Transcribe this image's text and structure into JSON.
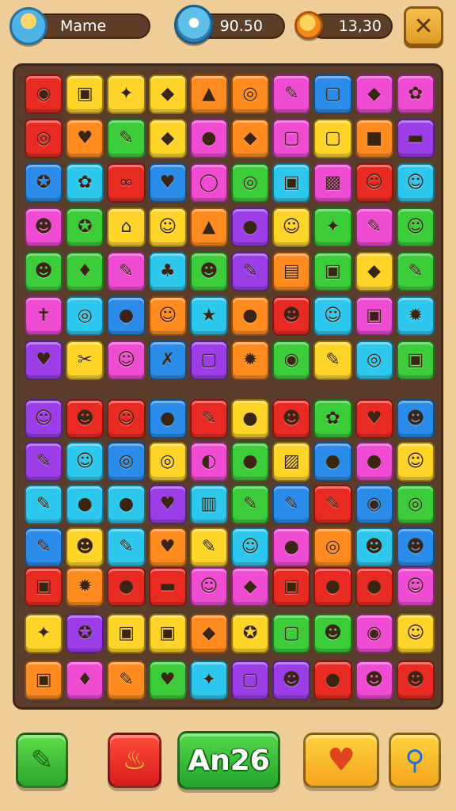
{
  "hud": {
    "player_name": "Mame",
    "gems": "90.50",
    "coins": "13,30",
    "close_glyph": "✕"
  },
  "colors": {
    "red": "#e82a22",
    "orange": "#ff8a1e",
    "yellow": "#ffd428",
    "green": "#3ccc3a",
    "blue": "#2a8be8",
    "cyan": "#2ec8ee",
    "purple": "#9b3ee8",
    "magenta": "#ef4bd3"
  },
  "board": {
    "sections": [
      {
        "rows": [
          [
            [
              "red",
              "◉"
            ],
            [
              "yellow",
              "▣"
            ],
            [
              "yellow",
              "✦"
            ],
            [
              "yellow",
              "◆"
            ],
            [
              "orange",
              "▲"
            ],
            [
              "orange",
              "◎"
            ],
            [
              "magenta",
              "✎"
            ],
            [
              "blue",
              "▢"
            ],
            [
              "magenta",
              "◆"
            ],
            [
              "magenta",
              "✿"
            ]
          ],
          [
            [
              "red",
              "◎"
            ],
            [
              "orange",
              "♥"
            ],
            [
              "green",
              "✎"
            ],
            [
              "yellow",
              "◆"
            ],
            [
              "magenta",
              "●"
            ],
            [
              "orange",
              "◆"
            ],
            [
              "magenta",
              "▢"
            ],
            [
              "yellow",
              "▢"
            ],
            [
              "orange",
              "■"
            ],
            [
              "purple",
              "▬"
            ]
          ],
          [
            [
              "blue",
              "✪"
            ],
            [
              "cyan",
              "✿"
            ],
            [
              "red",
              "∞"
            ],
            [
              "blue",
              "♥"
            ],
            [
              "magenta",
              "◯"
            ],
            [
              "green",
              "◎"
            ],
            [
              "cyan",
              "▣"
            ],
            [
              "magenta",
              "▩"
            ],
            [
              "red",
              "☺"
            ],
            [
              "cyan",
              "☺"
            ]
          ],
          [
            [
              "magenta",
              "☻"
            ],
            [
              "green",
              "✪"
            ],
            [
              "yellow",
              "⌂"
            ],
            [
              "yellow",
              "☺"
            ],
            [
              "orange",
              "▲"
            ],
            [
              "purple",
              "●"
            ],
            [
              "yellow",
              "☺"
            ],
            [
              "green",
              "✦"
            ],
            [
              "magenta",
              "✎"
            ],
            [
              "green",
              "☺"
            ]
          ],
          [
            [
              "green",
              "☻"
            ],
            [
              "green",
              "♦"
            ],
            [
              "magenta",
              "✎"
            ],
            [
              "cyan",
              "♣"
            ],
            [
              "green",
              "☻"
            ],
            [
              "purple",
              "✎"
            ],
            [
              "orange",
              "▤"
            ],
            [
              "green",
              "▣"
            ],
            [
              "yellow",
              "◆"
            ],
            [
              "green",
              "✎"
            ]
          ],
          [
            [
              "magenta",
              "✝"
            ],
            [
              "cyan",
              "◎"
            ],
            [
              "blue",
              "●"
            ],
            [
              "orange",
              "☺"
            ],
            [
              "cyan",
              "★"
            ],
            [
              "orange",
              "●"
            ],
            [
              "red",
              "☻"
            ],
            [
              "cyan",
              "☺"
            ],
            [
              "magenta",
              "▣"
            ],
            [
              "cyan",
              "✹"
            ]
          ],
          [
            [
              "purple",
              "♥"
            ],
            [
              "yellow",
              "✂"
            ],
            [
              "magenta",
              "☺"
            ],
            [
              "blue",
              "✗"
            ],
            [
              "purple",
              "▢"
            ],
            [
              "orange",
              "✹"
            ],
            [
              "green",
              "◉"
            ],
            [
              "yellow",
              "✎"
            ],
            [
              "cyan",
              "◎"
            ],
            [
              "green",
              "▣"
            ]
          ]
        ]
      },
      {
        "rows": [
          [
            [
              "purple",
              "☺"
            ],
            [
              "red",
              "☻"
            ],
            [
              "red",
              "☺"
            ],
            [
              "blue",
              "●"
            ],
            [
              "red",
              "✎"
            ],
            [
              "yellow",
              "●"
            ],
            [
              "red",
              "☻"
            ],
            [
              "green",
              "✿"
            ],
            [
              "red",
              "♥"
            ],
            [
              "blue",
              "☻"
            ]
          ],
          [
            [
              "purple",
              "✎"
            ],
            [
              "cyan",
              "☺"
            ],
            [
              "blue",
              "◎"
            ],
            [
              "yellow",
              "◎"
            ],
            [
              "magenta",
              "◐"
            ],
            [
              "green",
              "●"
            ],
            [
              "yellow",
              "▨"
            ],
            [
              "blue",
              "●"
            ],
            [
              "magenta",
              "●"
            ],
            [
              "yellow",
              "☺"
            ]
          ],
          [
            [
              "cyan",
              "✎"
            ],
            [
              "cyan",
              "●"
            ],
            [
              "cyan",
              "●"
            ],
            [
              "purple",
              "♥"
            ],
            [
              "cyan",
              "▥"
            ],
            [
              "green",
              "✎"
            ],
            [
              "blue",
              "✎"
            ],
            [
              "red",
              "✎"
            ],
            [
              "blue",
              "◉"
            ],
            [
              "green",
              "◎"
            ]
          ],
          [
            [
              "blue",
              "✎"
            ],
            [
              "yellow",
              "☻"
            ],
            [
              "cyan",
              "✎"
            ],
            [
              "orange",
              "♥"
            ],
            [
              "yellow",
              "✎"
            ],
            [
              "cyan",
              "☺"
            ],
            [
              "magenta",
              "●"
            ],
            [
              "orange",
              "◎"
            ],
            [
              "cyan",
              "☻"
            ],
            [
              "blue",
              "☻"
            ]
          ]
        ]
      },
      {
        "rows": [
          [
            [
              "red",
              "▣"
            ],
            [
              "orange",
              "✹"
            ],
            [
              "red",
              "●"
            ],
            [
              "red",
              "▬"
            ],
            [
              "magenta",
              "☺"
            ],
            [
              "magenta",
              "◆"
            ],
            [
              "red",
              "▣"
            ],
            [
              "red",
              "●"
            ],
            [
              "red",
              "●"
            ],
            [
              "magenta",
              "☺"
            ]
          ],
          [
            [
              "yellow",
              "✦"
            ],
            [
              "purple",
              "✪"
            ],
            [
              "yellow",
              "▣"
            ],
            [
              "yellow",
              "▣"
            ],
            [
              "orange",
              "◆"
            ],
            [
              "yellow",
              "✪"
            ],
            [
              "green",
              "▢"
            ],
            [
              "green",
              "☻"
            ],
            [
              "magenta",
              "◉"
            ],
            [
              "yellow",
              "☺"
            ]
          ],
          [
            [
              "orange",
              "▣"
            ],
            [
              "magenta",
              "♦"
            ],
            [
              "orange",
              "✎"
            ],
            [
              "green",
              "♥"
            ],
            [
              "cyan",
              "✦"
            ],
            [
              "purple",
              "▢"
            ],
            [
              "purple",
              "☻"
            ],
            [
              "red",
              "●"
            ],
            [
              "magenta",
              "☻"
            ],
            [
              "red",
              "☻"
            ]
          ]
        ]
      }
    ]
  },
  "bottom_bar": {
    "main_label": "An26",
    "pencil_glyph": "✎",
    "bucket_glyph": "♨",
    "heart_glyph": "♥",
    "search_glyph": "⚲"
  }
}
